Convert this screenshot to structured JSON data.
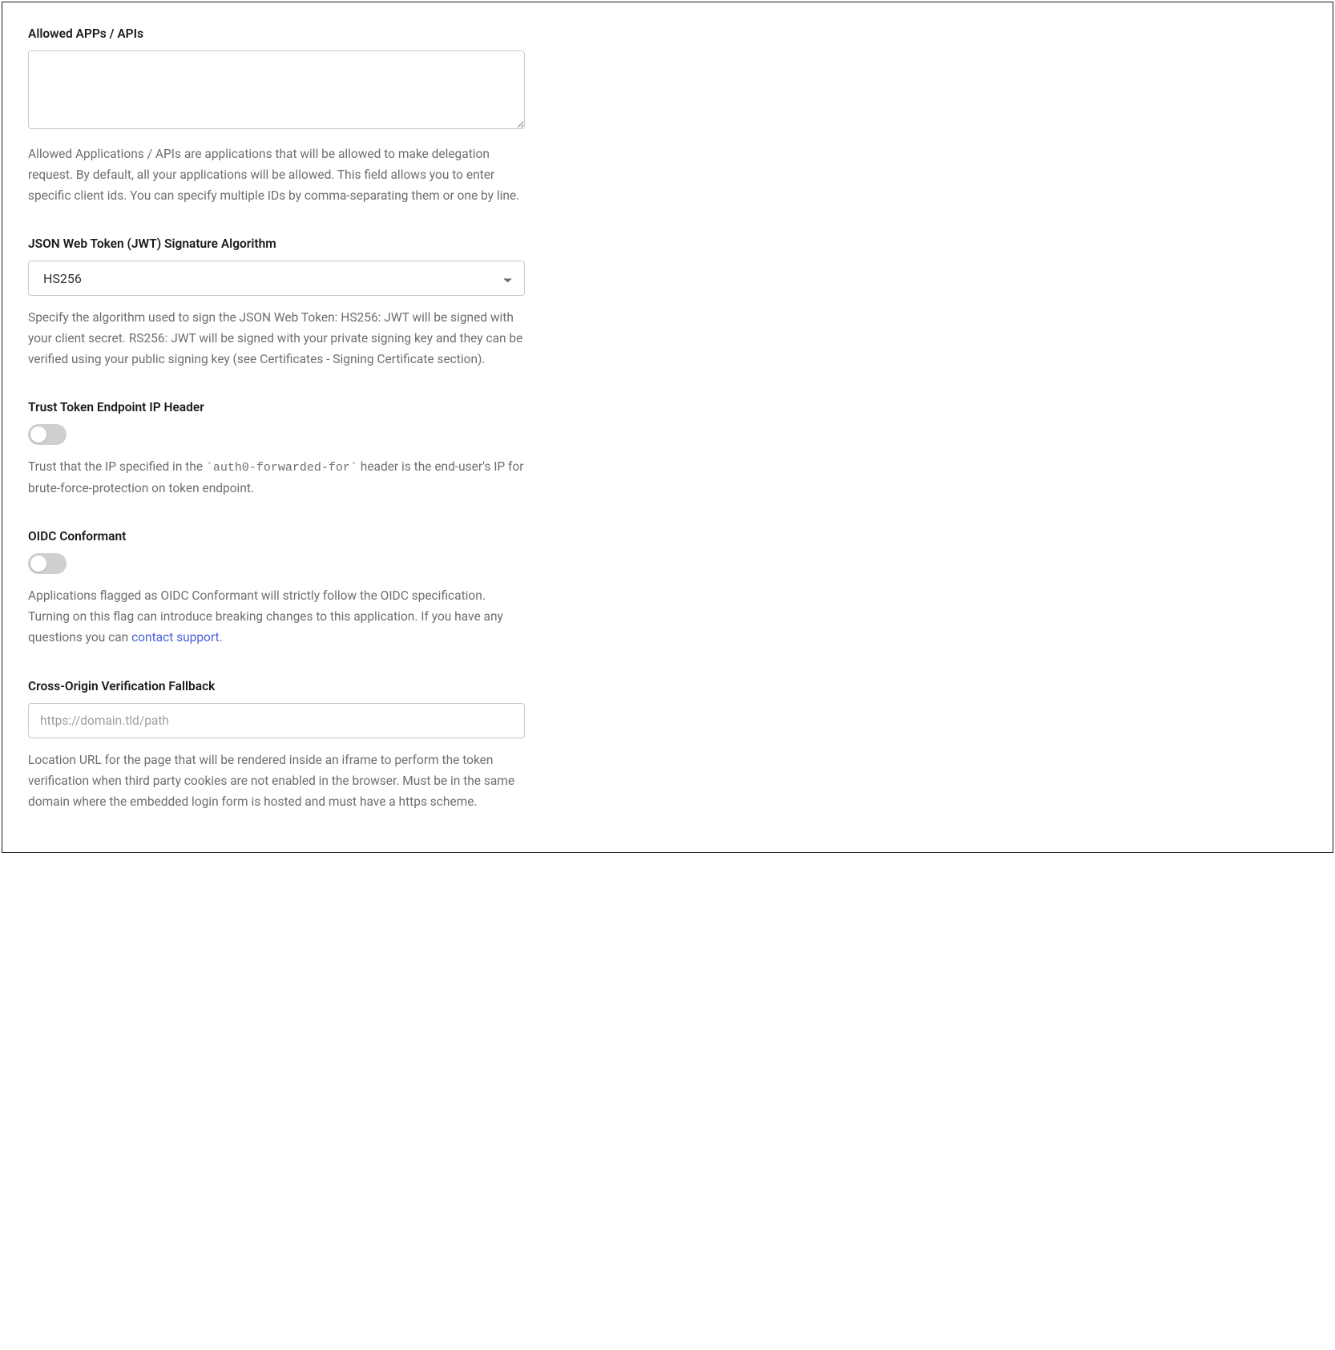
{
  "allowedApps": {
    "label": "Allowed APPs / APIs",
    "value": "",
    "help": "Allowed Applications / APIs are applications that will be allowed to make delegation request. By default, all your applications will be allowed. This field allows you to enter specific client ids. You can specify multiple IDs by comma-separating them or one by line."
  },
  "jwtAlgorithm": {
    "label": "JSON Web Token (JWT) Signature Algorithm",
    "selected": "HS256",
    "help": "Specify the algorithm used to sign the JSON Web Token: HS256: JWT will be signed with your client secret. RS256: JWT will be signed with your private signing key and they can be verified using your public signing key (see Certificates - Signing Certificate section)."
  },
  "trustTokenIp": {
    "label": "Trust Token Endpoint IP Header",
    "enabled": false,
    "helpPrefix": "Trust that the IP specified in the ",
    "helpCode": "`auth0-forwarded-for`",
    "helpSuffix": " header is the end-user's IP for brute-force-protection on token endpoint."
  },
  "oidcConformant": {
    "label": "OIDC Conformant",
    "enabled": false,
    "helpPrefix": "Applications flagged as OIDC Conformant will strictly follow the OIDC specification. Turning on this flag can introduce breaking changes to this application. If you have any questions you can ",
    "helpLink": "contact support",
    "helpSuffix": "."
  },
  "crossOriginFallback": {
    "label": "Cross-Origin Verification Fallback",
    "placeholder": "https://domain.tld/path",
    "value": "",
    "help": "Location URL for the page that will be rendered inside an iframe to perform the token verification when third party cookies are not enabled in the browser. Must be in the same domain where the embedded login form is hosted and must have a https scheme."
  }
}
